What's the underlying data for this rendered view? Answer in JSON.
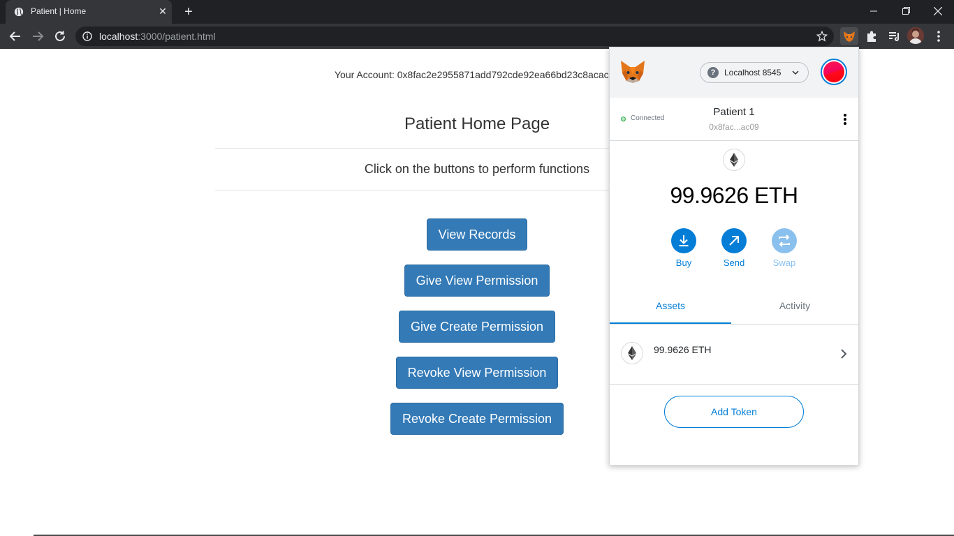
{
  "browser": {
    "tab_title": "Patient | Home",
    "tab_close": "✕",
    "new_tab": "+",
    "url_host": "localhost",
    "url_rest": ":3000/patient.html"
  },
  "page": {
    "account_label": "Your Account: 0x8fac2e2955871add792cde92ea66bd23c8acac",
    "title": "Patient Home Page",
    "subtitle": "Click on the buttons to perform functions",
    "buttons": [
      "View Records",
      "Give View Permission",
      "Give Create Permission",
      "Revoke View Permission",
      "Revoke Create Permission"
    ],
    "button_color": "#337ab7"
  },
  "metamask": {
    "network": "Localhost 8545",
    "connected_label": "Connected",
    "account_name": "Patient 1",
    "account_address": "0x8fac...ac09",
    "balance": "99.9626 ETH",
    "actions": {
      "buy": "Buy",
      "send": "Send",
      "swap": "Swap"
    },
    "tabs": {
      "assets": "Assets",
      "activity": "Activity"
    },
    "asset_row_label": "99.9626 ETH",
    "add_token": "Add Token",
    "accent_color": "#037dd6"
  }
}
